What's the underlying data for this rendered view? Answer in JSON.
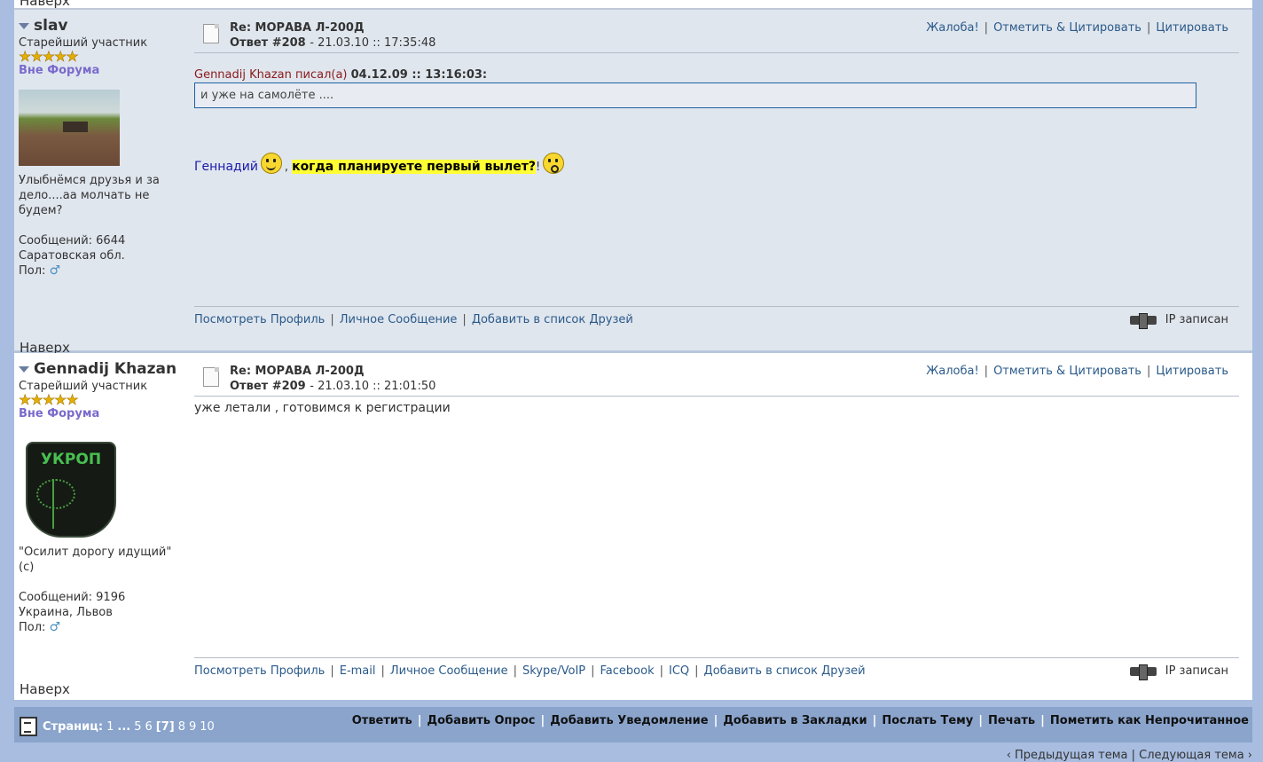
{
  "top_cut_text": "Наверх",
  "posts": [
    {
      "username": "slav",
      "rank": "Старейший участник",
      "stars": "★★★★★",
      "status": "Вне Форума",
      "signature": "Улыбнёмся друзья и за дело....аа молчать не будем?",
      "messages": "Сообщений: 6644",
      "location": "Саратовская обл.",
      "gender_label": "Пол:",
      "subject": "Re: МОРАВА Л-200Д",
      "reply_label": "Ответ #208",
      "date": "- 21.03.10 :: 17:35:48",
      "actions": [
        "Жалоба!",
        "Отметить & Цитировать",
        "Цитировать"
      ],
      "quote_author": "Gennadij Khazan писал(а)",
      "quote_date": "04.12.09 :: 13:16:03:",
      "quote_text": "и уже на самолёте ....",
      "message_name": "Геннадий",
      "message_comma": ",",
      "message_highlight": "когда планируете первый вылет?",
      "message_excl": "!",
      "bottom_links": [
        "Посмотреть Профиль",
        "Личное Сообщение",
        "Добавить в список Друзей"
      ],
      "ip_text": "IP записан",
      "up_link": "Наверх"
    },
    {
      "username": "Gennadij Khazan",
      "rank": "Старейший участник",
      "stars": "★★★★★",
      "status": "Вне Форума",
      "avatar_text": "УКРОП",
      "signature": "\"Осилит дорогу идущий\"(с)",
      "messages": "Сообщений: 9196",
      "location": "Украина, Львов",
      "gender_label": "Пол:",
      "subject": "Re: МОРАВА Л-200Д",
      "reply_label": "Ответ #209",
      "date": "- 21.03.10 :: 21:01:50",
      "actions": [
        "Жалоба!",
        "Отметить & Цитировать",
        "Цитировать"
      ],
      "message": "уже летали , готовимся к регистрации",
      "bottom_links": [
        "Посмотреть Профиль",
        "E-mail",
        "Личное Сообщение",
        "Skype/VoIP",
        "Facebook",
        "ICQ",
        "Добавить в список Друзей"
      ],
      "ip_text": "IP записан",
      "up_link": "Наверх"
    }
  ],
  "footer": {
    "pages_label": "Страниц:",
    "pages": [
      "1",
      "...",
      "5",
      "6",
      "[7]",
      "8",
      "9",
      "10"
    ],
    "actions": [
      "Ответить",
      "Добавить Опрос",
      "Добавить Уведомление",
      "Добавить в Закладки",
      "Послать Тему",
      "Печать",
      "Пометить как Непрочитанное"
    ]
  },
  "nav_bottom": "‹ Предыдущая тема | Следующая тема ›"
}
